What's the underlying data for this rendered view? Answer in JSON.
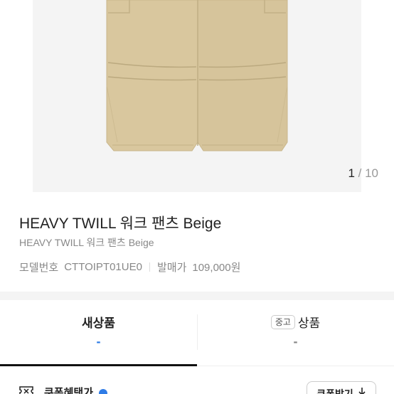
{
  "gallery": {
    "image_icon": "pants-photo",
    "counter_current": "1",
    "counter_sep_total": " / 10"
  },
  "product": {
    "title": "HEAVY TWILL 워크 팬츠 Beige",
    "subtitle": "HEAVY TWILL 워크 팬츠 Beige",
    "model_label": "모델번호",
    "model_value": "CTTOIPT01UE0",
    "release_label": "발매가",
    "release_value": "109,000원"
  },
  "tabs": {
    "new_label": "새상품",
    "new_price": "-",
    "used_badge": "중고",
    "used_label": "상품",
    "used_price": "-"
  },
  "coupon": {
    "label": "쿠폰혜택가",
    "button_label": "쿠폰받기",
    "icon": "coupon-icon",
    "button_icon": "download-icon"
  },
  "colors": {
    "accent": "#2f7ce6",
    "pants": "#d9c79e"
  }
}
